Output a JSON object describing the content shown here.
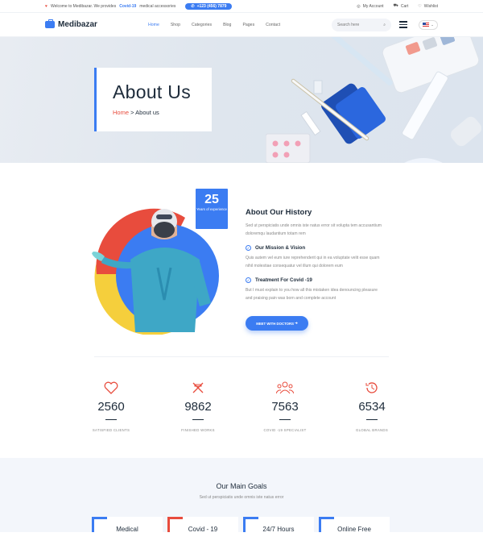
{
  "topbar": {
    "welcome_prefix": "Welcome to Medibazar. We provides",
    "covid": "Covid-19",
    "welcome_suffix": "medical accessories",
    "phone": "+123 (456) 7879",
    "my_account": "My Account",
    "cart": "Cart",
    "wishlist": "Wishlist"
  },
  "nav": {
    "logo": "Medibazar",
    "menu": [
      "Home",
      "Shop",
      "Categories",
      "Blog",
      "Pages",
      "Contact"
    ],
    "search_placeholder": "Search here"
  },
  "hero": {
    "title": "About Us",
    "breadcrumb_home": "Home",
    "breadcrumb_sep": ">",
    "breadcrumb_current": "About us"
  },
  "about": {
    "years": "25",
    "years_label": "Years of experience",
    "heading": "About Our History",
    "intro": "Sed ut perspiciatis unde omnis iste natus error sit volupta tem accusantium doloremqu laudantium totam rem",
    "mission_title": "Our Mission & Vision",
    "mission_text": "Quis autem vel eum iure reprehenderit qui in ea voluptate velit esse quam nihil molestiae consequatur vel illum qui dolorem eum",
    "treatment_title": "Treatment For Covid -19",
    "treatment_text": "But I must explain to you how all this mistaken idea denouncing pleasure and praising pain was born and complete account",
    "button": "MEET WITH DOCTORS"
  },
  "stats": [
    {
      "icon": "heart-icon",
      "value": "2560",
      "label": "SATISFIED CLIENTS"
    },
    {
      "icon": "tools-icon",
      "value": "9862",
      "label": "FINISHED WORKS"
    },
    {
      "icon": "team-icon",
      "value": "7563",
      "label": "COVID -19 SPECIALIST"
    },
    {
      "icon": "history-icon",
      "value": "6534",
      "label": "GLOBAL BRANDS"
    }
  ],
  "goals": {
    "heading": "Our Main Goals",
    "subheading": "Sed ut perspiciatis unde omnis iste natus error",
    "cards": [
      "Medical",
      "Covid - 19",
      "24/7 Hours",
      "Online Free"
    ]
  },
  "colors": {
    "accent": "#3b7cf2",
    "red": "#e84c3d",
    "yellow": "#f5cf3c"
  }
}
